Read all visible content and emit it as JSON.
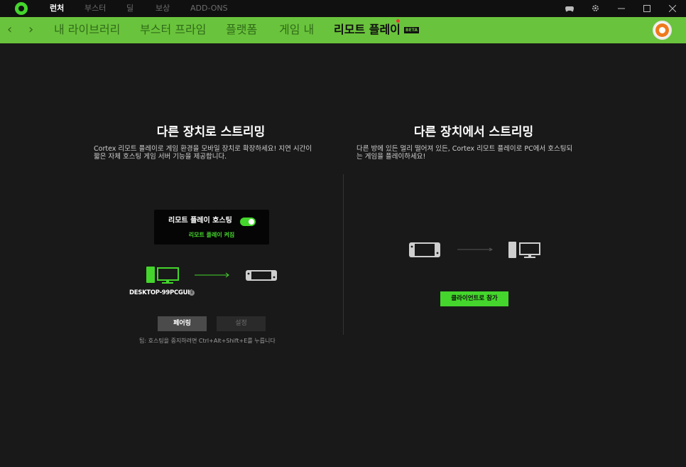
{
  "titlebar": {
    "tabs": [
      {
        "label": "런처",
        "active": true
      },
      {
        "label": "부스터",
        "active": false
      },
      {
        "label": "딜",
        "active": false
      },
      {
        "label": "보상",
        "active": false
      },
      {
        "label": "ADD-ONS",
        "active": false
      }
    ],
    "icons": [
      "gamepad-icon",
      "settings-icon",
      "minimize-icon",
      "maximize-icon",
      "close-icon"
    ]
  },
  "navbar": {
    "back": "‹",
    "forward": "›",
    "items": [
      {
        "label": "내 라이브러리",
        "active": false
      },
      {
        "label": "부스터 프라임",
        "active": false
      },
      {
        "label": "플랫폼",
        "active": false
      },
      {
        "label": "게임 내",
        "active": false
      },
      {
        "label": "리모트 플레이",
        "active": true
      }
    ],
    "beta_badge": "BETA",
    "accent_color": "#6ac33c"
  },
  "left_panel": {
    "title": "다른 장치로 스트리밍",
    "description_line1": "Cortex 리모트 플레이로 게임 환경을 모바일 장치로 확장하세요! 지연 시간이",
    "description_line2": "짧은 자체 호스팅 게임 서버 기능을 제공합니다.",
    "host_card": {
      "label": "리모트 플레이 호스팅",
      "toggle_on": true,
      "status": "리모트 플레이 켜짐"
    },
    "device_name": "DESKTOP-99PCGUK",
    "info_glyph": "i",
    "pair_button": "페어링",
    "settings_button": "설정",
    "tip": "팁: 호스팅을 중지하려면 Ctrl+Alt+Shift+E를 누릅니다"
  },
  "right_panel": {
    "title": "다른 장치에서 스트리밍",
    "description_line1": "다른 방에 있든 멀리 떨어져 있든, Cortex 리모트 플레이로 PC에서 호스팅되",
    "description_line2": "는 게임을 플레이하세요!",
    "join_button": "클라이언트로 참가"
  }
}
